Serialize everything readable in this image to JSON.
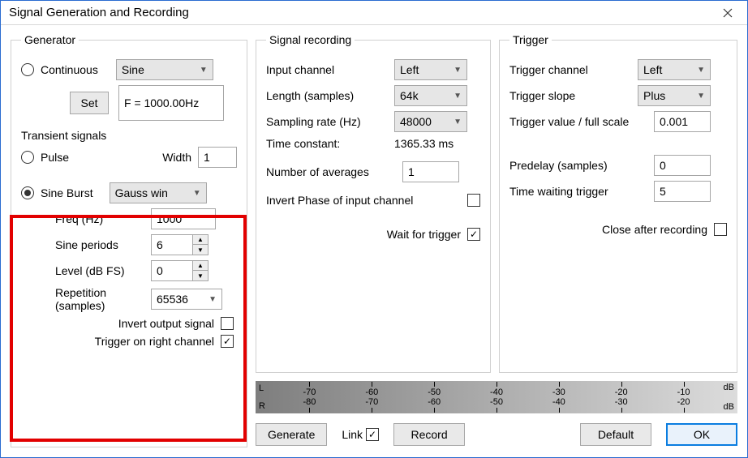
{
  "window": {
    "title": "Signal Generation and Recording"
  },
  "generator": {
    "legend": "Generator",
    "continuous": {
      "label": "Continuous",
      "waveform": "Sine",
      "set_btn": "Set",
      "freq_readout": "F = 1000.00Hz"
    },
    "transient_header": "Transient signals",
    "pulse": {
      "label": "Pulse",
      "width_label": "Width",
      "width_value": "1"
    },
    "sineburst": {
      "label": "Sine Burst",
      "window": "Gauss win",
      "freq_label": "Freq (Hz)",
      "freq_value": "1000",
      "periods_label": "Sine periods",
      "periods_value": "6",
      "level_label": "Level (dB FS)",
      "level_value": "0",
      "rep_label1": "Repetition",
      "rep_label2": "(samples)",
      "rep_value": "65536",
      "invert_label": "Invert output signal",
      "trigger_right_label": "Trigger on right channel"
    }
  },
  "recording": {
    "legend": "Signal recording",
    "input_channel_label": "Input channel",
    "input_channel_value": "Left",
    "length_label": "Length (samples)",
    "length_value": "64k",
    "rate_label": "Sampling rate (Hz)",
    "rate_value": "48000",
    "tc_label": "Time constant:",
    "tc_value": "1365.33 ms",
    "navg_label": "Number of averages",
    "navg_value": "1",
    "invert_phase_label": "Invert Phase of input channel",
    "wait_trigger_label": "Wait for trigger"
  },
  "trigger": {
    "legend": "Trigger",
    "channel_label": "Trigger channel",
    "channel_value": "Left",
    "slope_label": "Trigger slope",
    "slope_value": "Plus",
    "value_label": "Trigger value / full scale",
    "value_value": "0.001",
    "predelay_label": "Predelay (samples)",
    "predelay_value": "0",
    "wait_label": "Time waiting trigger",
    "wait_value": "5",
    "close_after_label": "Close after recording"
  },
  "meter": {
    "ticks": [
      "-70",
      "-60",
      "-50",
      "-40",
      "-30",
      "-20",
      "-10"
    ],
    "bottom": [
      "-80",
      "-70",
      "-60",
      "-50",
      "-40",
      "-30",
      "-20"
    ],
    "db": "dB",
    "L": "L",
    "R": "R",
    "db2": "dB"
  },
  "buttons": {
    "generate": "Generate",
    "link": "Link",
    "record": "Record",
    "default": "Default",
    "ok": "OK"
  }
}
